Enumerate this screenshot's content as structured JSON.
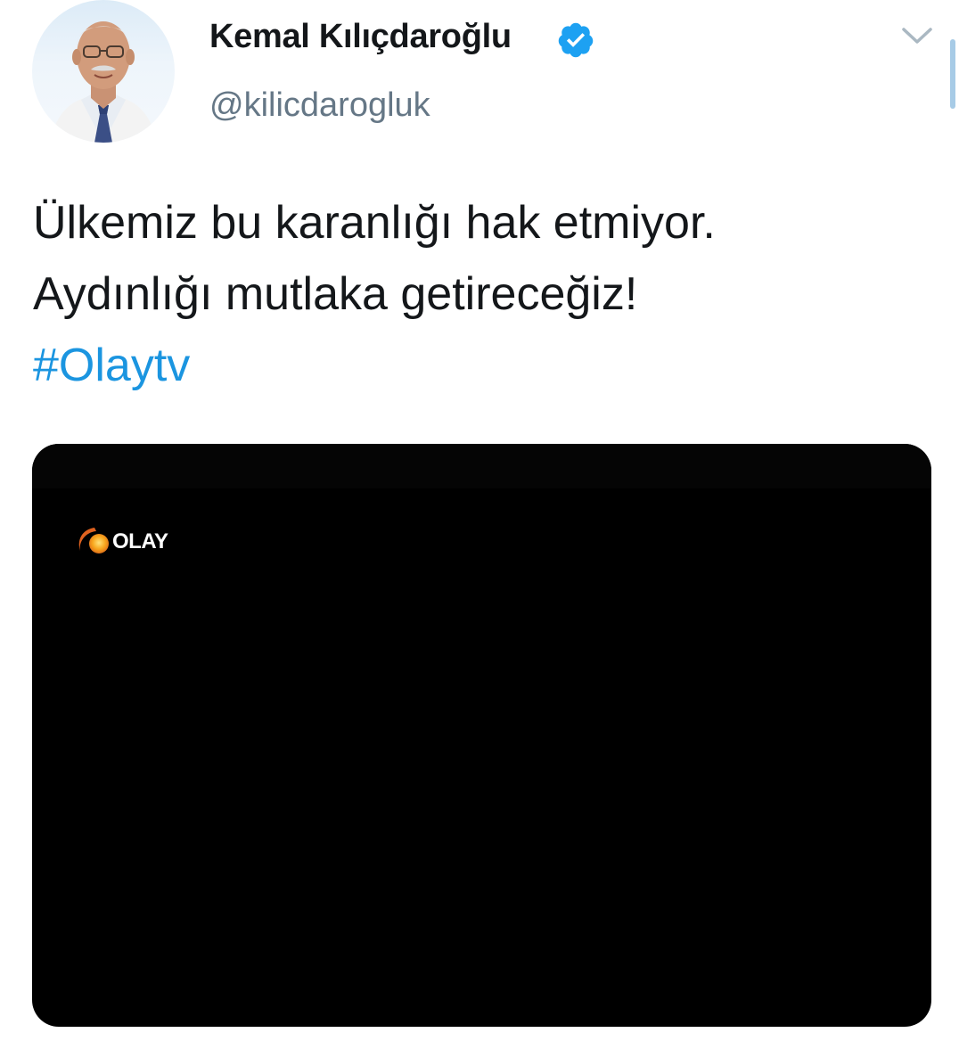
{
  "tweet": {
    "author": {
      "display_name": "Kemal Kılıçdaroğlu",
      "handle": "@kilicdarogluk",
      "verified": true,
      "verified_icon": "verified-badge-icon",
      "avatar_icon": "profile-photo"
    },
    "text_lines": [
      "Ülkemiz bu karanlığı hak etmiyor.",
      "Aydınlığı mutlaka getireceğiz!"
    ],
    "hashtag": "#Olaytv",
    "menu_icon": "chevron-down-icon",
    "media": {
      "type": "image",
      "logo_text": "OLAY"
    }
  },
  "colors": {
    "text": "#14171a",
    "secondary": "#657786",
    "link": "#1b95e0",
    "verified": "#1da1f2",
    "media_background": "#000000"
  }
}
